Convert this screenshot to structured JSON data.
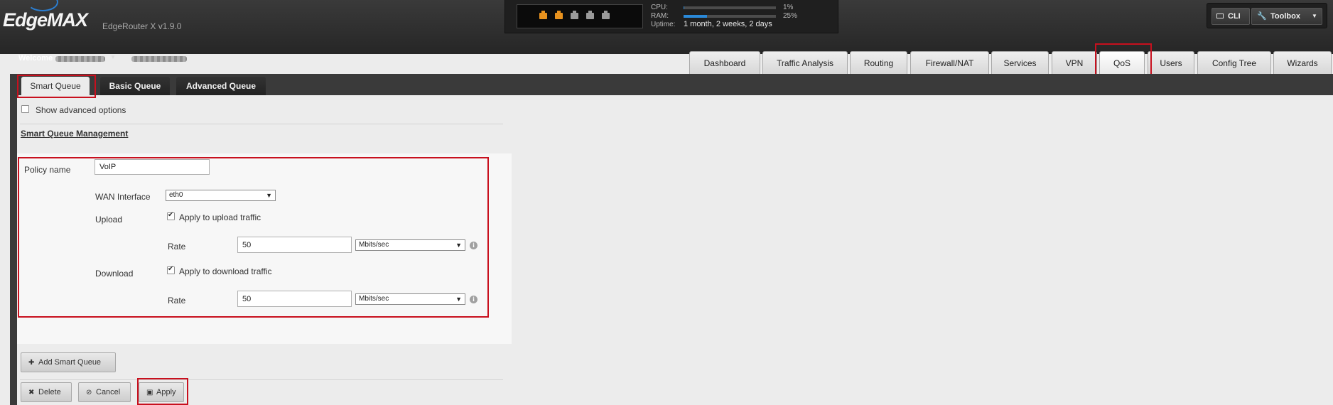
{
  "app": {
    "logo": "EdgeMAX",
    "version": "EdgeRouter X v1.9.0"
  },
  "status": {
    "ports": [
      "#e8921e",
      "#e8921e",
      "#9a9a9a",
      "#9a9a9a",
      "#9a9a9a"
    ],
    "cpu_label": "CPU:",
    "cpu_value": "1%",
    "cpu_level_percent": 1,
    "ram_label": "RAM:",
    "ram_value": "25%",
    "ram_level_percent": 25,
    "uptime_label": "Uptime:",
    "uptime_value": "1 month, 2 weeks, 2 days"
  },
  "toolbar": {
    "cli_label": "CLI",
    "toolbox_label": "Toolbox"
  },
  "user": {
    "welcome_label": "Welcome"
  },
  "nav": {
    "tabs": [
      {
        "label": "Dashboard"
      },
      {
        "label": "Traffic Analysis"
      },
      {
        "label": "Routing"
      },
      {
        "label": "Firewall/NAT"
      },
      {
        "label": "Services"
      },
      {
        "label": "VPN"
      },
      {
        "label": "QoS",
        "active": true
      },
      {
        "label": "Users"
      },
      {
        "label": "Config Tree"
      },
      {
        "label": "Wizards"
      }
    ]
  },
  "subtabs": [
    {
      "label": "Smart Queue",
      "active": true
    },
    {
      "label": "Basic Queue"
    },
    {
      "label": "Advanced Queue"
    }
  ],
  "options": {
    "show_advanced_label": "Show advanced options",
    "show_advanced_checked": false
  },
  "section_title": "Smart Queue Management",
  "policy": {
    "name_label": "Policy name",
    "name_value": "VoIP",
    "wan_label": "WAN Interface",
    "wan_value": "eth0",
    "upload_label": "Upload",
    "upload_apply_label": "Apply to upload traffic",
    "upload_checked": true,
    "upload_rate_label": "Rate",
    "upload_rate_value": "50",
    "upload_unit": "Mbits/sec",
    "download_label": "Download",
    "download_apply_label": "Apply to download traffic",
    "download_checked": true,
    "download_rate_label": "Rate",
    "download_rate_value": "50",
    "download_unit": "Mbits/sec"
  },
  "buttons": {
    "add_smart_queue": "Add Smart Queue",
    "delete": "Delete",
    "cancel": "Cancel",
    "apply": "Apply"
  },
  "colors": {
    "highlight": "#c8101e",
    "accent": "#2a89d8"
  }
}
